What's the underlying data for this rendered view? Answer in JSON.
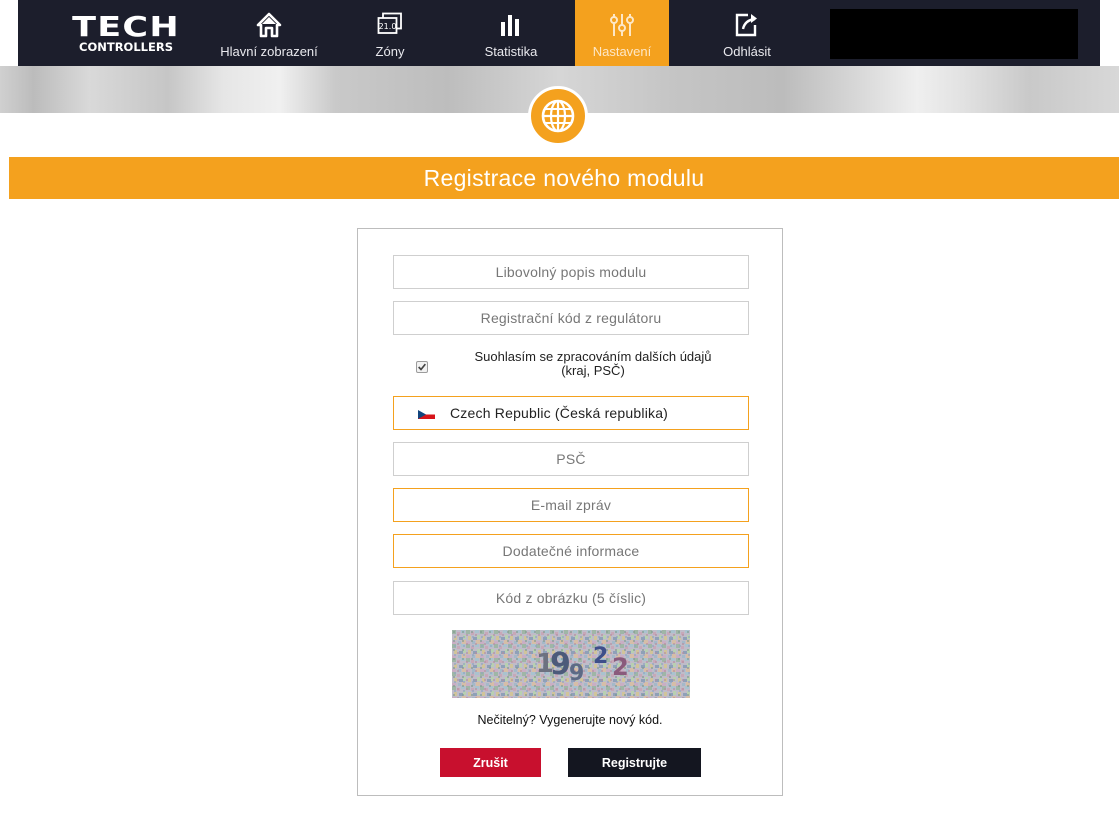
{
  "header": {
    "logo_top": "TECH",
    "logo_bottom": "CONTROLLERS",
    "nav": [
      {
        "label": "Hlavní zobrazení",
        "icon": "home-icon"
      },
      {
        "label": "Zóny",
        "icon": "zones-display-icon",
        "badge": "21.0"
      },
      {
        "label": "Statistika",
        "icon": "bar-chart-icon"
      },
      {
        "label": "Nastavení",
        "icon": "sliders-icon",
        "active": true
      },
      {
        "label": "Odhlásit",
        "icon": "logout-icon"
      }
    ]
  },
  "page": {
    "banner_icon": "globe-icon",
    "title": "Registrace nového modulu"
  },
  "form": {
    "description_placeholder": "Libovolný popis modulu",
    "code_placeholder": "Registrační kód z regulátoru",
    "consent_line1": "Suohlasím se zpracováním dalších údajů",
    "consent_line2": "(kraj, PSČ)",
    "consent_checked": true,
    "country_value": "Czech Republic (Česká republika)",
    "country_flag": "czech-flag-icon",
    "postcode_placeholder": "PSČ",
    "email_placeholder": "E-mail zpráv",
    "additional_placeholder": "Dodatečné informace",
    "captcha_placeholder": "Kód z obrázku (5 číslic)",
    "captcha_chars": [
      "1",
      "9",
      "9",
      "2",
      "2"
    ],
    "regenerate_text": "Nečitelný? Vygenerujte nový kód.",
    "cancel_label": "Zrušit",
    "register_label": "Registrujte"
  },
  "colors": {
    "accent": "#f4a11e",
    "navbar": "#1c1e2c",
    "cancel": "#c8102e",
    "register": "#141620"
  }
}
